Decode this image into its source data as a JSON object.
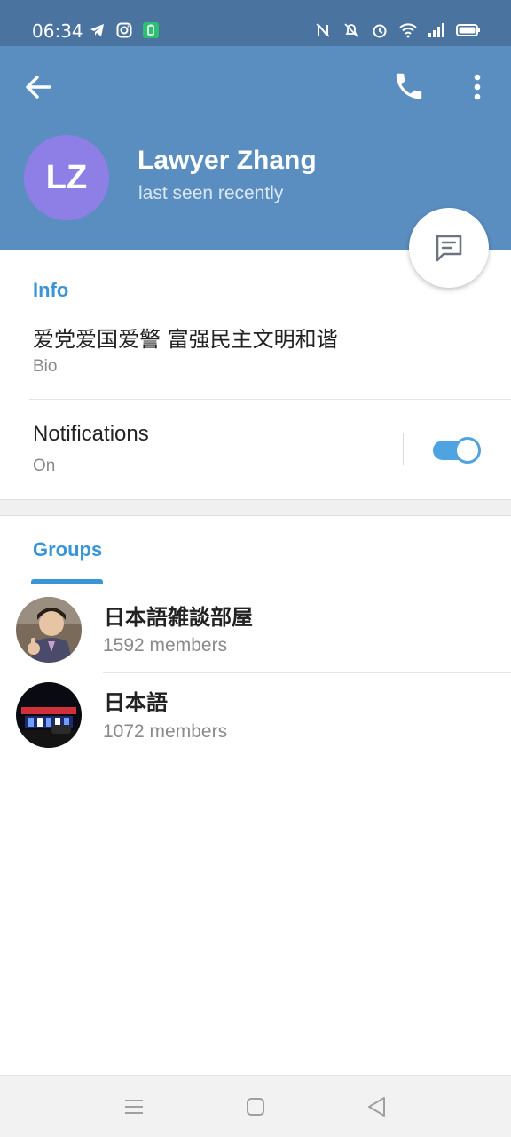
{
  "status_bar": {
    "time": "06:34",
    "left_icons": [
      "telegram-icon",
      "instagram-icon",
      "battery-app-icon"
    ],
    "right_icons": [
      "nfc-icon",
      "vibrate-off-icon",
      "alarm-icon",
      "wifi-icon",
      "signal-icon",
      "battery-icon"
    ]
  },
  "header": {
    "avatar_initials": "LZ",
    "name": "Lawyer Zhang",
    "status": "last seen recently",
    "avatar_color": "#8e7fe6",
    "background_color": "#5b8ec0"
  },
  "info": {
    "title": "Info",
    "bio_value": "爱党爱国爱警 富强民主文明和谐",
    "bio_label": "Bio",
    "notifications_label": "Notifications",
    "notifications_value": "On",
    "notifications_enabled": true
  },
  "groups_tab": {
    "label": "Groups"
  },
  "groups": [
    {
      "name": "日本語雑談部屋",
      "members": "1592 members"
    },
    {
      "name": "日本語",
      "members": "1072 members"
    }
  ],
  "accent_color": "#3a95d6"
}
